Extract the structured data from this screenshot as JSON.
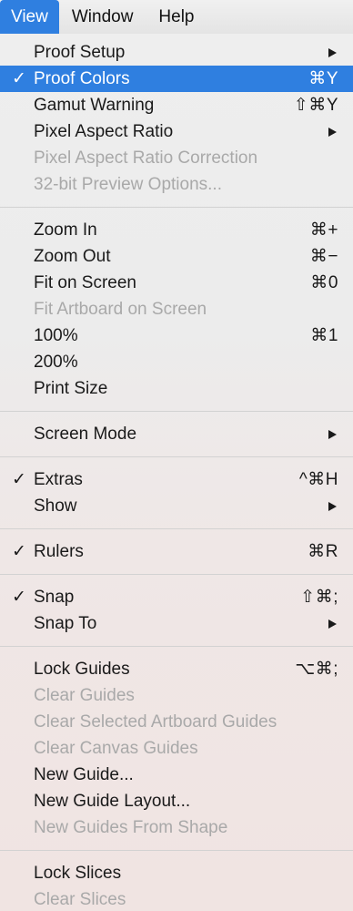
{
  "menubar": {
    "items": [
      {
        "label": "View"
      },
      {
        "label": "Window"
      },
      {
        "label": "Help"
      }
    ]
  },
  "menu": {
    "groups": [
      {
        "items": [
          {
            "label": "Proof Setup",
            "checked": false,
            "shortcut": "",
            "submenu": true,
            "disabled": false
          },
          {
            "label": "Proof Colors",
            "checked": true,
            "check_glyph": "✓",
            "shortcut": "⌘Y",
            "submenu": false,
            "disabled": false,
            "highlighted": true
          },
          {
            "label": "Gamut Warning",
            "checked": false,
            "shortcut": "⇧⌘Y",
            "submenu": false,
            "disabled": false
          },
          {
            "label": "Pixel Aspect Ratio",
            "checked": false,
            "shortcut": "",
            "submenu": true,
            "disabled": false
          },
          {
            "label": "Pixel Aspect Ratio Correction",
            "checked": false,
            "shortcut": "",
            "submenu": false,
            "disabled": true
          },
          {
            "label": "32-bit Preview Options...",
            "checked": false,
            "shortcut": "",
            "submenu": false,
            "disabled": true
          }
        ]
      },
      {
        "items": [
          {
            "label": "Zoom In",
            "shortcut": "⌘+",
            "disabled": false
          },
          {
            "label": "Zoom Out",
            "shortcut": "⌘−",
            "disabled": false
          },
          {
            "label": "Fit on Screen",
            "shortcut": "⌘0",
            "disabled": false
          },
          {
            "label": "Fit Artboard on Screen",
            "shortcut": "",
            "disabled": true
          },
          {
            "label": "100%",
            "shortcut": "⌘1",
            "disabled": false
          },
          {
            "label": "200%",
            "shortcut": "",
            "disabled": false
          },
          {
            "label": "Print Size",
            "shortcut": "",
            "disabled": false
          }
        ]
      },
      {
        "items": [
          {
            "label": "Screen Mode",
            "submenu": true,
            "disabled": false
          }
        ]
      },
      {
        "items": [
          {
            "label": "Extras",
            "check_glyph": "✓",
            "shortcut": "^⌘H",
            "disabled": false
          },
          {
            "label": "Show",
            "submenu": true,
            "disabled": false
          }
        ]
      },
      {
        "items": [
          {
            "label": "Rulers",
            "check_glyph": "✓",
            "shortcut": "⌘R",
            "disabled": false
          }
        ]
      },
      {
        "items": [
          {
            "label": "Snap",
            "check_glyph": "✓",
            "shortcut": "⇧⌘;",
            "disabled": false
          },
          {
            "label": "Snap To",
            "submenu": true,
            "disabled": false
          }
        ]
      },
      {
        "items": [
          {
            "label": "Lock Guides",
            "shortcut": "⌥⌘;",
            "disabled": false
          },
          {
            "label": "Clear Guides",
            "disabled": true
          },
          {
            "label": "Clear Selected Artboard Guides",
            "disabled": true
          },
          {
            "label": "Clear Canvas Guides",
            "disabled": true
          },
          {
            "label": "New Guide...",
            "disabled": false
          },
          {
            "label": "New Guide Layout...",
            "disabled": false
          },
          {
            "label": "New Guides From Shape",
            "disabled": true
          }
        ]
      },
      {
        "items": [
          {
            "label": "Lock Slices",
            "disabled": false
          },
          {
            "label": "Clear Slices",
            "disabled": true
          }
        ]
      }
    ]
  },
  "colors": {
    "highlight": "#2f7fe0",
    "text": "#1a1a1a",
    "disabled_text": "#a9a9a9",
    "separator": "#d2d2d2"
  }
}
